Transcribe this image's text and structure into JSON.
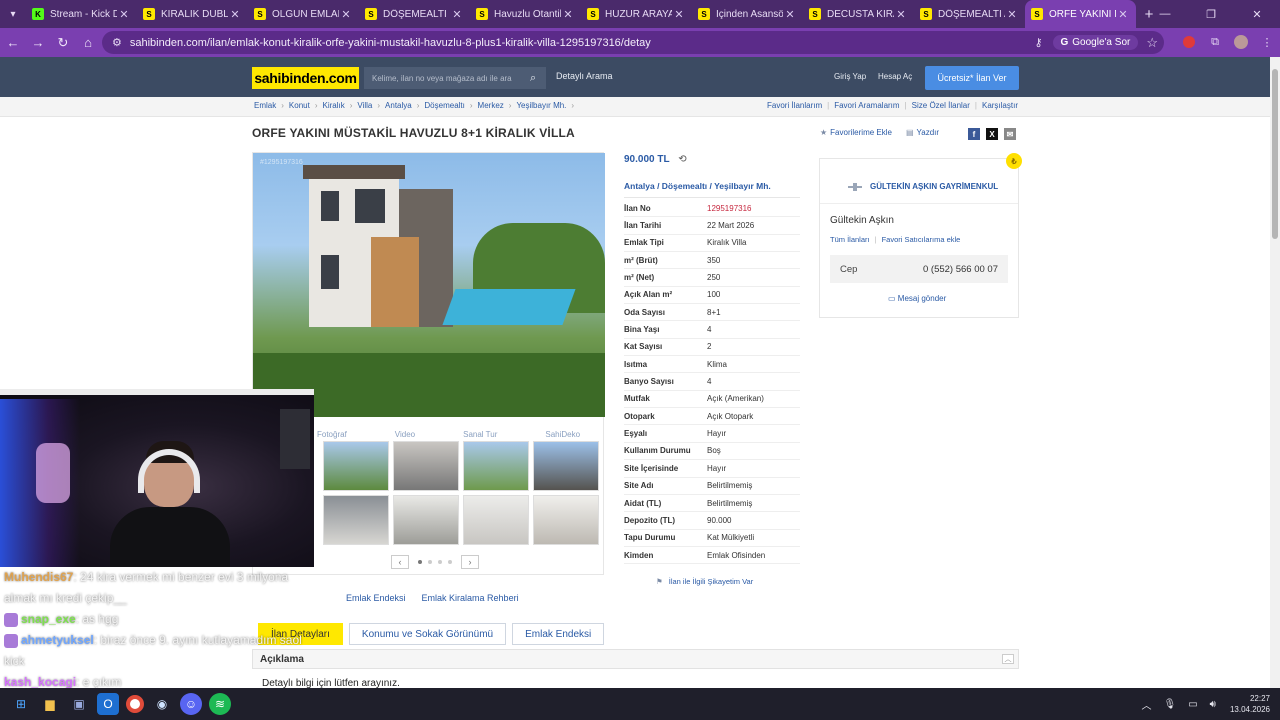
{
  "browser": {
    "tabs": [
      {
        "label": "Stream - Kick Da",
        "fav_color": "#53fc18",
        "fav_text": "K"
      },
      {
        "label": "KİRALIK DUBLEKS",
        "fav_color": "#ffe800",
        "fav_text": "S"
      },
      {
        "label": "OLGUN EMLAK-M",
        "fav_color": "#ffe800",
        "fav_text": "S"
      },
      {
        "label": "DÖŞEMEALTI MÜ",
        "fav_color": "#ffe800",
        "fav_text": "S"
      },
      {
        "label": "Havuzlu Otantik S",
        "fav_color": "#ffe800",
        "fav_text": "S"
      },
      {
        "label": "HUZUR ARAYANL",
        "fav_color": "#ffe800",
        "fav_text": "S"
      },
      {
        "label": "İçinden Asansörlü",
        "fav_color": "#ffe800",
        "fav_text": "S"
      },
      {
        "label": "DECUSTA KİRALIK",
        "fav_color": "#ffe800",
        "fav_text": "S"
      },
      {
        "label": "DÖŞEMEALTI Alt",
        "fav_color": "#ffe800",
        "fav_text": "S"
      },
      {
        "label": "ORFE YAKINI MÜ",
        "fav_color": "#ffe800",
        "fav_text": "S",
        "active": true
      }
    ],
    "url": "sahibinden.com/ilan/emlak-konut-kiralik-orfe-yakini-mustakil-havuzlu-8-plus1-kiralik-villa-1295197316/detay",
    "google_lens_label": "Google'a Sor"
  },
  "site": {
    "logo": "sahibinden.com",
    "search_placeholder": "Kelime, ilan no veya mağaza adı ile ara",
    "advanced_search": "Detaylı Arama",
    "login": "Giriş Yap",
    "register": "Hesap Aç",
    "cta": "Ücretsiz* İlan Ver"
  },
  "breadcrumbs": [
    "Emlak",
    "Konut",
    "Kiralık",
    "Villa",
    "Antalya",
    "Döşemealtı",
    "Merkez",
    "Yeşilbayır Mh."
  ],
  "quick_links": [
    "Favori İlanlarım",
    "Favori Aramalarım",
    "Size Özel İlanlar",
    "Karşılaştır"
  ],
  "listing": {
    "title": "ORFE YAKINI MÜSTAKİL HAVUZLU 8+1 KİRALIK VİLLA",
    "favorite_label": "Favorilerime Ekle",
    "print_label": "Yazdır",
    "photo_id": "#1295197316",
    "gallery_tabs": [
      "Fotoğraf",
      "Video",
      "Sanal Tur",
      "SahiDeko"
    ],
    "price": "90.000 TL",
    "location": "Antalya  /  Döşemealtı  /  Yeşilbayır Mh.",
    "details": [
      {
        "k": "İlan No",
        "v": "1295197316",
        "red": true
      },
      {
        "k": "İlan Tarihi",
        "v": "22 Mart 2026"
      },
      {
        "k": "Emlak Tipi",
        "v": "Kiralık Villa"
      },
      {
        "k": "m² (Brüt)",
        "v": "350"
      },
      {
        "k": "m² (Net)",
        "v": "250"
      },
      {
        "k": "Açık Alan m²",
        "v": "100"
      },
      {
        "k": "Oda Sayısı",
        "v": "8+1"
      },
      {
        "k": "Bina Yaşı",
        "v": "4"
      },
      {
        "k": "Kat Sayısı",
        "v": "2"
      },
      {
        "k": "Isıtma",
        "v": "Klima"
      },
      {
        "k": "Banyo Sayısı",
        "v": "4"
      },
      {
        "k": "Mutfak",
        "v": "Açık (Amerikan)"
      },
      {
        "k": "Otopark",
        "v": "Açık Otopark"
      },
      {
        "k": "Eşyalı",
        "v": "Hayır"
      },
      {
        "k": "Kullanım Durumu",
        "v": "Boş"
      },
      {
        "k": "Site İçerisinde",
        "v": "Hayır"
      },
      {
        "k": "Site Adı",
        "v": "Belirtilmemiş"
      },
      {
        "k": "Aidat (TL)",
        "v": "Belirtilmemiş"
      },
      {
        "k": "Depozito (TL)",
        "v": "90.000"
      },
      {
        "k": "Tapu Durumu",
        "v": "Kat Mülkiyetli"
      },
      {
        "k": "Kimden",
        "v": "Emlak Ofisinden"
      }
    ],
    "complaint": "İlan ile İlgili Şikayetim Var",
    "under_gallery_links": [
      "Emlak Endeksi",
      "Emlak Kiralama Rehberi"
    ],
    "section_tabs": [
      "İlan Detayları",
      "Konumu ve Sokak Görünümü",
      "Emlak Endeksi"
    ],
    "description_heading": "Açıklama",
    "description_text": "Detaylı bilgi için lütfen arayınız."
  },
  "seller": {
    "firm": "GÜLTEKİN AŞKIN GAYRİMENKUL",
    "name": "Gültekin Aşkın",
    "all_listings": "Tüm İlanları",
    "add_fav_seller": "Favori Satıcılarıma ekle",
    "phone_label": "Cep",
    "phone": "0 (552) 566 00 07",
    "message": "Mesaj gönder"
  },
  "chat": [
    {
      "user": "Muhendis67",
      "color": "#e0a34f",
      "text": ": 24 kira vermek mi benzer evi 3 milyona almak mı kredi çekip__"
    },
    {
      "user": "snap_exe",
      "color": "#7ee04f",
      "text": ": as hgg",
      "emote": true
    },
    {
      "user": "ahmetyuksel",
      "color": "#6fa6ff",
      "text": ": biraz önce 9. ayını kutlayamadım saol kick",
      "emote": true
    },
    {
      "user": "kash_kocagi",
      "color": "#d673ff",
      "text": ": e çıkım"
    }
  ],
  "taskbar": {
    "time": "22:27",
    "date": "13.04.2026"
  },
  "colors": {
    "brand_yellow": "#ffe800",
    "header_navy": "#3c4b63",
    "link_blue": "#2a5aa5",
    "browser_purple": "#7a3fb0"
  }
}
